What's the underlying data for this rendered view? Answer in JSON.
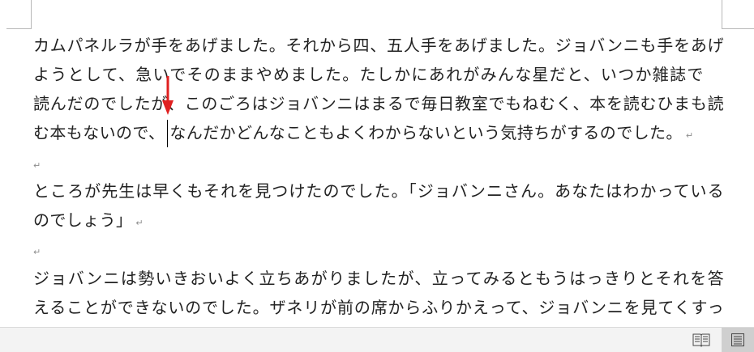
{
  "document": {
    "lines": [
      "カムパネルラが手をあげました。それから四、五人手をあげました。ジョバンニも手をあげ",
      "ようとして、急いでそのままやめました。たしかにあれがみんな星だと、いつか雑誌で",
      "読んだのでしたが、このごろはジョバンニはまるで毎日教室でもねむく、本を読むひまも読",
      "む本もないので、",
      "なんだかどんなこともよくわからないという気持ちがするのでした。",
      "ところが先生は早くもそれを見つけたのでした。「ジョバンニさん。あなたはわかっている",
      "のでしょう」",
      "ジョバンニは勢いきおいよく立ちあがりましたが、立ってみるともうはっきりとそれを答",
      "えることができないのでした。ザネリが前の席からふりかえって、ジョバンニを見てくすっ"
    ],
    "paragraph_mark": "↵"
  },
  "annotations": {
    "arrow_color": "#e02020"
  },
  "status_bar": {
    "read_mode_icon": "read-mode-icon",
    "print_layout_icon": "print-layout-icon"
  }
}
